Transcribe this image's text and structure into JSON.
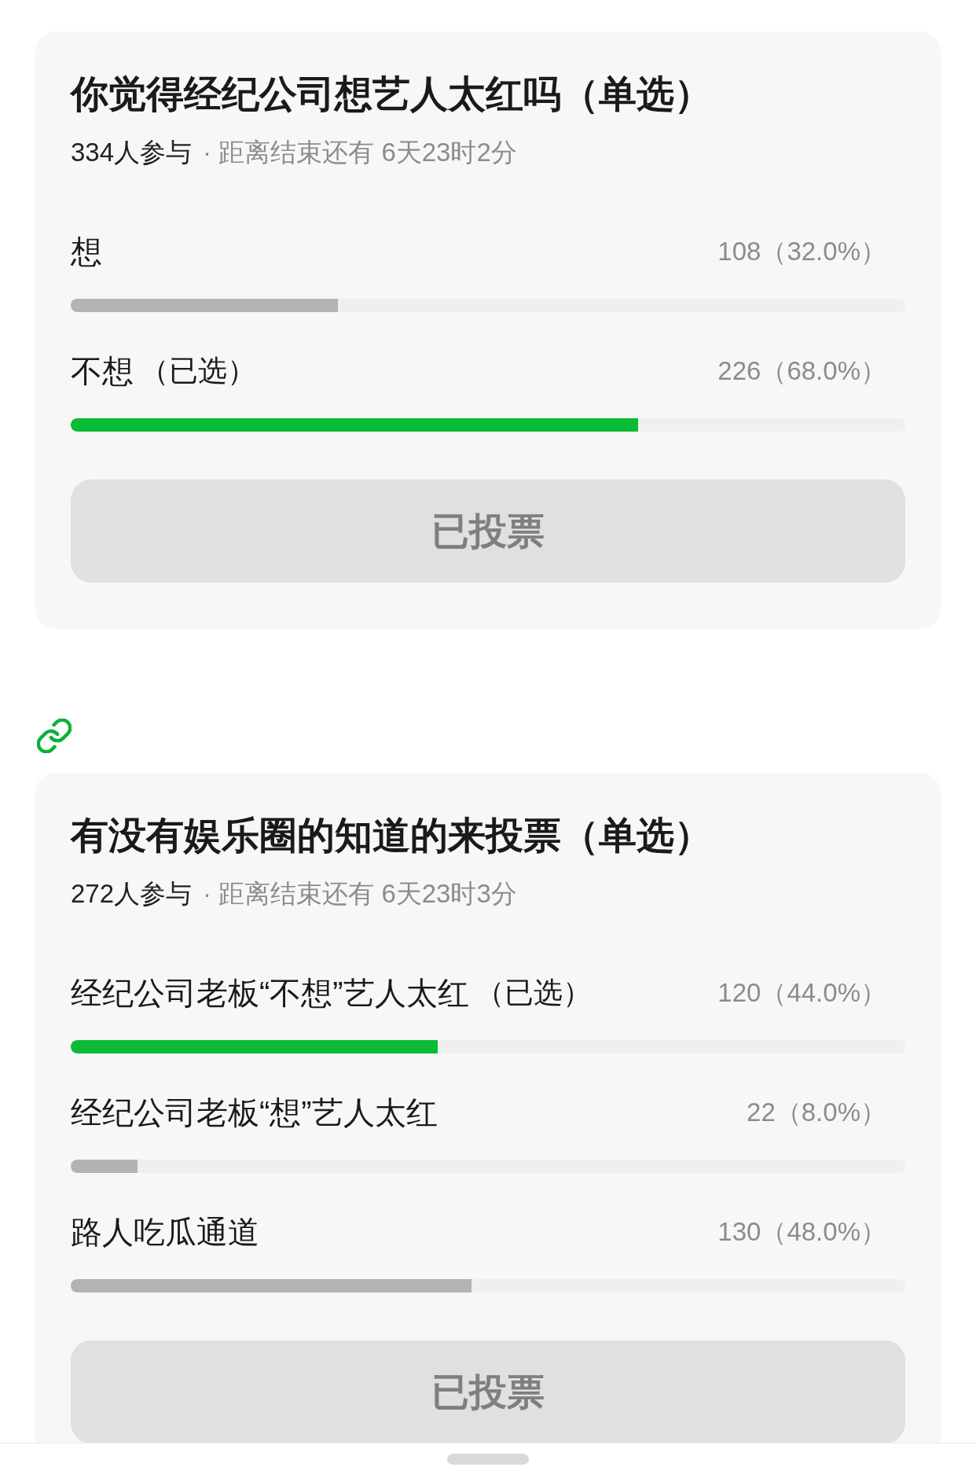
{
  "blocks": [
    {
      "kind": "poll",
      "title": "你觉得经纪公司想艺人太红吗（单选）",
      "participants": "334人参与",
      "deadline": "· 距离结束还有 6天23时2分",
      "options": [
        {
          "label": "想",
          "selected": false,
          "count": "108（32.0%）",
          "level": 0.32
        },
        {
          "label": "不想",
          "selected": true,
          "tag": "（已选）",
          "count": "226（68.0%）",
          "level": 0.68
        }
      ],
      "button": {
        "label": "已投票",
        "disabled": true
      }
    },
    {
      "kind": "link"
    },
    {
      "kind": "poll",
      "title": "有没有娱乐圈的知道的来投票（单选）",
      "participants": "272人参与",
      "deadline": "· 距离结束还有 6天23时3分",
      "options": [
        {
          "label": "经纪公司老板“不想”艺人太红",
          "selected": true,
          "tag": "（已选）",
          "count": "120（44.0%）",
          "level": 0.44
        },
        {
          "label": "经纪公司老板“想”艺人太红",
          "selected": false,
          "count": "22（8.0%）",
          "level": 0.08
        },
        {
          "label": "路人吃瓜通道",
          "selected": false,
          "count": "130（48.0%）",
          "level": 0.48
        }
      ],
      "button": {
        "label": "已投票",
        "disabled": true
      }
    }
  ]
}
